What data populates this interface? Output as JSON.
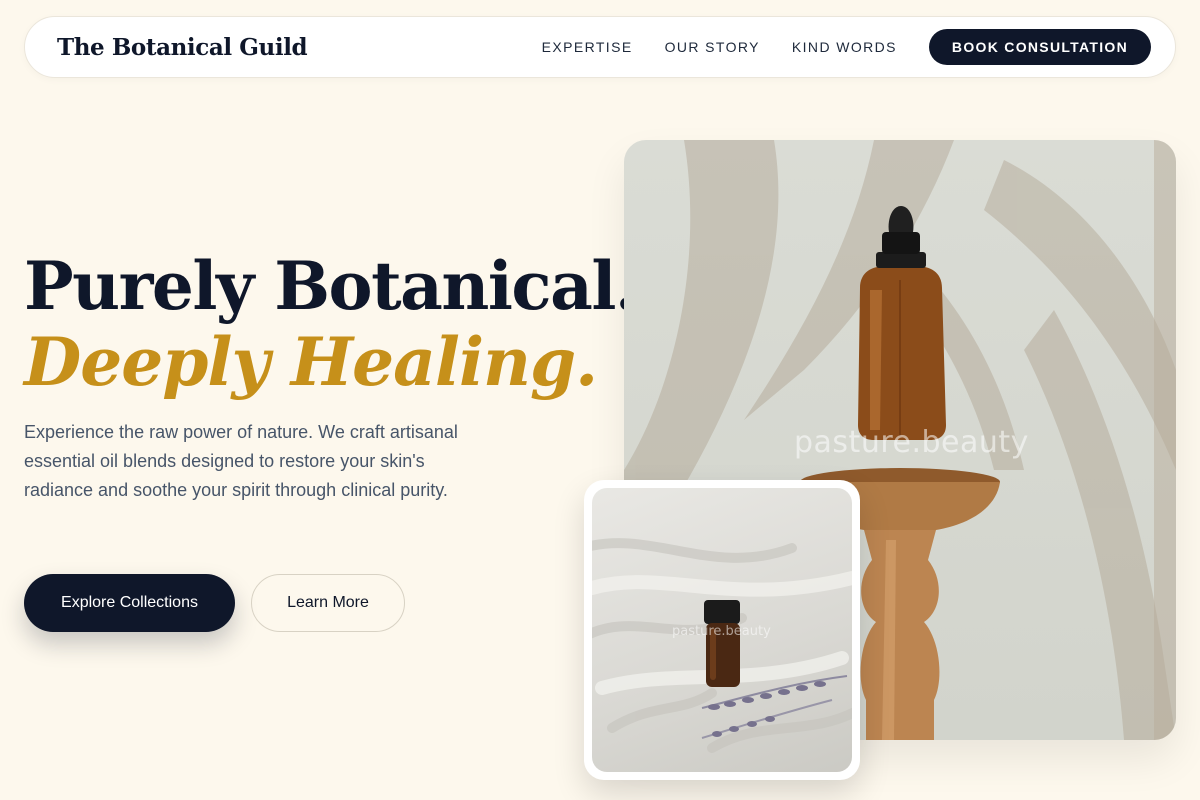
{
  "navbar": {
    "brand": "The Botanical Guild",
    "links": [
      "EXPERTISE",
      "OUR STORY",
      "KIND WORDS"
    ],
    "cta": "BOOK CONSULTATION"
  },
  "hero": {
    "title_line1": "Purely Botanical.",
    "title_line2": "Deeply Healing.",
    "description": "Experience the raw power of nature. We craft artisanal essential oil blends designed to restore your skin's radiance and soothe your spirit through clinical purity.",
    "primary_button": "Explore Collections",
    "secondary_button": "Learn More"
  },
  "images": {
    "main_watermark": "pasture.beauty",
    "secondary_watermark": "pasture.beauty"
  },
  "colors": {
    "page_background": "#fdf8ed",
    "navy": "#0f172a",
    "gold_accent": "#c6901a",
    "body_text": "#475569"
  }
}
